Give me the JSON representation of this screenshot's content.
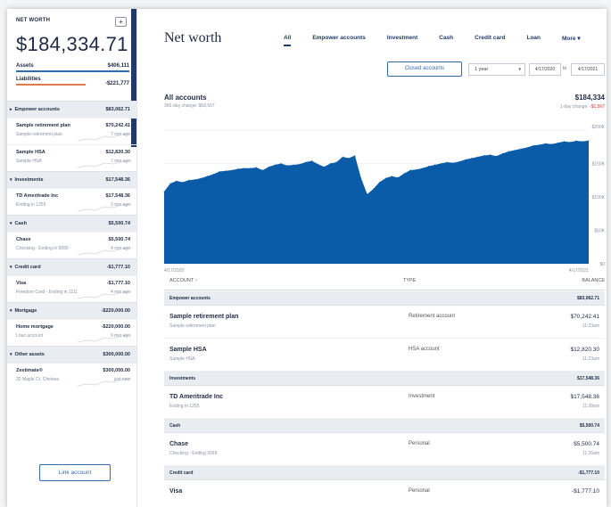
{
  "sidebar": {
    "title": "NET WORTH",
    "add_label": "+",
    "total": "$184,334.71",
    "assets": {
      "label": "Assets",
      "value": "$406,111"
    },
    "liabilities": {
      "label": "Liabilities",
      "value": "-$221,777"
    },
    "groups": [
      {
        "label": "Empower accounts",
        "value": "$83,062.71",
        "caret": "▸",
        "items": [
          {
            "name": "Sample retirement plan",
            "value": "$70,242.41",
            "sub": "Sample retirement plan",
            "time": "7 min ago"
          },
          {
            "name": "Sample HSA",
            "value": "$12,820.30",
            "sub": "Sample HSA",
            "time": "7 min ago"
          }
        ]
      },
      {
        "label": "Investments",
        "value": "$17,548.36",
        "caret": "▾",
        "items": [
          {
            "name": "TD Ameritrade Inc",
            "value": "$17,548.36",
            "sub": "Ending in 1255",
            "time": "2 min ago"
          }
        ]
      },
      {
        "label": "Cash",
        "value": "$5,500.74",
        "caret": "▾",
        "items": [
          {
            "name": "Chase",
            "value": "$5,500.74",
            "sub": "Checking - Ending in 9999",
            "time": "4 min ago"
          }
        ]
      },
      {
        "label": "Credit card",
        "value": "-$1,777.10",
        "caret": "▾",
        "items": [
          {
            "name": "Visa",
            "value": "-$1,777.10",
            "sub": "Freedom Card - Ending in 1111",
            "time": "4 min ago"
          }
        ]
      },
      {
        "label": "Mortgage",
        "value": "-$220,000.00",
        "caret": "▾",
        "items": [
          {
            "name": "Home mortgage",
            "value": "-$220,000.00",
            "sub": "Loan account",
            "time": "9 min ago"
          }
        ]
      },
      {
        "label": "Other assets",
        "value": "$300,000.00",
        "caret": "▾",
        "items": [
          {
            "name": "Zestimate®",
            "value": "$300,000.00",
            "sub": "32 Maple Ct, Chelsea",
            "time": "just now"
          }
        ]
      }
    ],
    "link_account_label": "Link account"
  },
  "main": {
    "title": "Net worth",
    "tabs": [
      {
        "label": "All",
        "active": true
      },
      {
        "label": "Empower accounts",
        "active": false
      },
      {
        "label": "Investment",
        "active": false
      },
      {
        "label": "Cash",
        "active": false
      },
      {
        "label": "Credit card",
        "active": false
      },
      {
        "label": "Loan",
        "active": false
      },
      {
        "label": "More ▾",
        "active": false
      }
    ],
    "closed_accounts_label": "Closed accounts",
    "period_select": "1 year",
    "date_from": "4/17/2020",
    "date_to_label": "to",
    "date_to": "4/17/2021",
    "summary": {
      "title": "All accounts",
      "total": "$184,334",
      "change_label": "366-day change: $68,567",
      "day_change_label": "1-day change:",
      "day_change_value": "-$1,567"
    }
  },
  "chart_data": {
    "type": "area",
    "title": "",
    "xlabel": "",
    "ylabel": "",
    "x_labels": [
      "4/17/2020",
      "4/17/2021"
    ],
    "y_ticks": [
      "$200K",
      "$150K",
      "$100K",
      "$50K",
      "$0"
    ],
    "ylim": [
      0,
      200000
    ],
    "grid": true,
    "color": "#0b5ca8",
    "values": [
      108000,
      120000,
      124000,
      122000,
      125000,
      126000,
      128000,
      131000,
      134000,
      138000,
      139000,
      140000,
      142000,
      143000,
      143000,
      144000,
      140000,
      145000,
      148000,
      150000,
      147000,
      148000,
      149000,
      152000,
      154000,
      149000,
      145000,
      150000,
      152000,
      160000,
      158000,
      162000,
      128000,
      104000,
      112000,
      122000,
      128000,
      131000,
      129000,
      135000,
      140000,
      141000,
      143000,
      146000,
      148000,
      150000,
      152000,
      151000,
      153000,
      156000,
      158000,
      160000,
      162000,
      163000,
      161000,
      165000,
      168000,
      170000,
      172000,
      174000,
      177000,
      178000,
      180000,
      179000,
      181000,
      183000,
      182000,
      184000,
      183000,
      184334
    ]
  },
  "table": {
    "columns": [
      "ACCOUNT ↑",
      "TYPE",
      "BALANCE"
    ],
    "groups": [
      {
        "label": "Empower accounts",
        "value": "$83,062.71",
        "rows": [
          {
            "name": "Sample retirement plan",
            "sub": "Sample retirement plan",
            "type": "Retirement account",
            "balance": "$70,242.41",
            "time": "11:23am"
          },
          {
            "name": "Sample HSA",
            "sub": "Sample HSA",
            "type": "HSA account",
            "balance": "$12,820.30",
            "time": "11:23am"
          }
        ]
      },
      {
        "label": "Investments",
        "value": "$17,548.36",
        "rows": [
          {
            "name": "TD Ameritrade Inc",
            "sub": "Ending in 1255",
            "type": "Investment",
            "balance": "$17,548.36",
            "time": "11:28am"
          }
        ]
      },
      {
        "label": "Cash",
        "value": "$5,500.74",
        "rows": [
          {
            "name": "Chase",
            "sub": "Checking - Ending 9999",
            "type": "Personal",
            "balance": "$5,500.74",
            "time": "11:26am"
          }
        ]
      },
      {
        "label": "Credit card",
        "value": "-$1,777.10",
        "rows": [
          {
            "name": "Visa",
            "sub": "",
            "type": "Personal",
            "balance": "-$1,777.10",
            "time": ""
          }
        ]
      }
    ]
  }
}
